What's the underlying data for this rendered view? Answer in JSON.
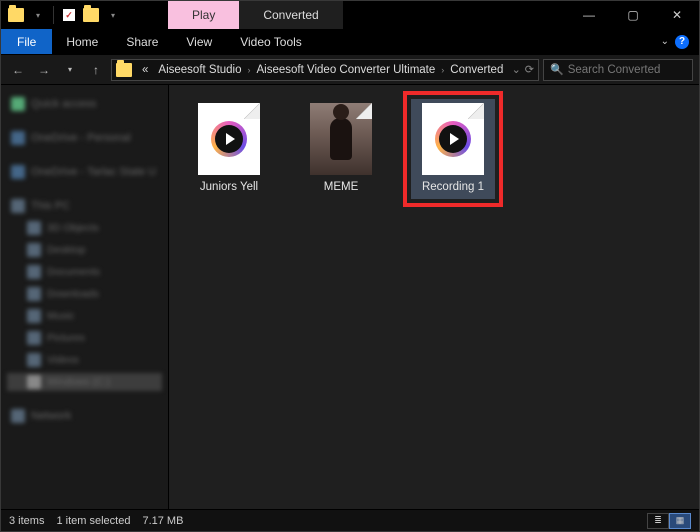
{
  "titlebar": {
    "context_tab": "Play",
    "window_title": "Converted"
  },
  "ribbon": {
    "file": "File",
    "tabs": [
      "Home",
      "Share",
      "View",
      "Video Tools"
    ]
  },
  "address": {
    "crumbs_prefix": "«",
    "crumbs": [
      "Aiseesoft Studio",
      "Aiseesoft Video Converter Ultimate",
      "Converted"
    ],
    "search_placeholder": "Search Converted"
  },
  "sidebar": {
    "items": [
      {
        "label": "Quick access",
        "ico": "star",
        "indent": false
      },
      {
        "label": "OneDrive - Personal",
        "ico": "o",
        "indent": false
      },
      {
        "label": "OneDrive - Tarlac State U",
        "ico": "o",
        "indent": false
      },
      {
        "label": "This PC",
        "ico": "pc",
        "indent": false
      },
      {
        "label": "3D Objects",
        "ico": "pc",
        "indent": true
      },
      {
        "label": "Desktop",
        "ico": "pc",
        "indent": true
      },
      {
        "label": "Documents",
        "ico": "pc",
        "indent": true
      },
      {
        "label": "Downloads",
        "ico": "pc",
        "indent": true
      },
      {
        "label": "Music",
        "ico": "pc",
        "indent": true
      },
      {
        "label": "Pictures",
        "ico": "pc",
        "indent": true
      },
      {
        "label": "Videos",
        "ico": "pc",
        "indent": true
      },
      {
        "label": "Windows (C:)",
        "ico": "drv",
        "indent": true,
        "selected": true
      },
      {
        "label": "Network",
        "ico": "net",
        "indent": false
      }
    ]
  },
  "files": [
    {
      "name": "Juniors Yell",
      "kind": "video",
      "selected": false,
      "highlight": false
    },
    {
      "name": "MEME",
      "kind": "photo",
      "selected": false,
      "highlight": false
    },
    {
      "name": "Recording 1",
      "kind": "video",
      "selected": true,
      "highlight": true
    }
  ],
  "status": {
    "count": "3 items",
    "selection": "1 item selected",
    "size": "7.17 MB"
  }
}
